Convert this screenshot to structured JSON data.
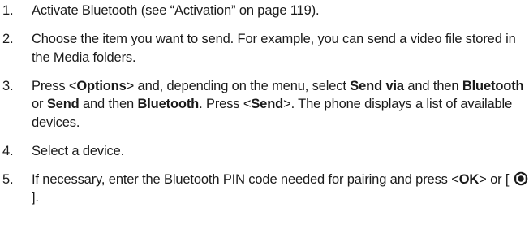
{
  "steps": [
    {
      "number": "1.",
      "t1": "Activate Bluetooth (see “Activation” on page 119)."
    },
    {
      "number": "2.",
      "t1": "Choose the item you want to send. For example, you can send a video file stored in the Media folders."
    },
    {
      "number": "3.",
      "t1": "Press <",
      "b1": "Options",
      "t2": "> and, depending on the menu, select ",
      "b2": "Send via",
      "t3": " and then ",
      "b3": "Bluetooth",
      "t4": " or ",
      "b4": "Send",
      "t5": " and then ",
      "b5": "Bluetooth",
      "t6": ". Press <",
      "b6": "Send",
      "t7": ">. The phone displays a list of available devices."
    },
    {
      "number": "4.",
      "t1": "Select a device."
    },
    {
      "number": "5.",
      "t1": "If necessary, enter the Bluetooth PIN code needed for pairing and press <",
      "b1": "OK",
      "t2": "> or [ ",
      "icon": "navigation-key-icon",
      "t3": " ]."
    }
  ]
}
